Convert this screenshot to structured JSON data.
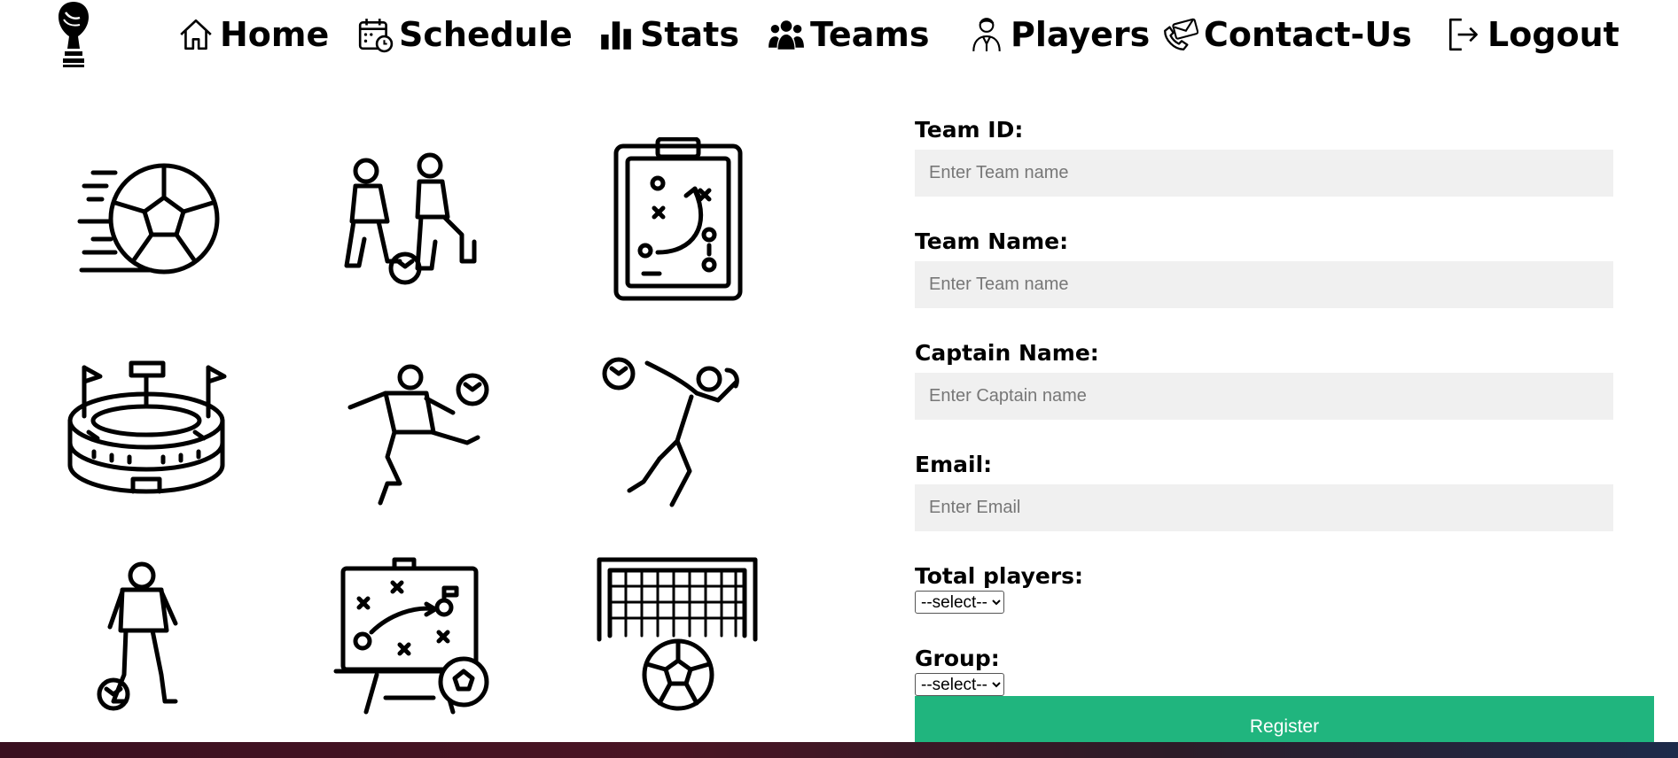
{
  "nav": {
    "home": "Home",
    "schedule": "Schedule",
    "stats": "Stats",
    "teams": "Teams",
    "players": "Players",
    "contact": "Contact-Us",
    "logout": "Logout"
  },
  "icons": {
    "logo": "trophy-icon",
    "home": "house-icon",
    "schedule": "calendar-clock-icon",
    "stats": "bar-chart-icon",
    "teams": "group-icon",
    "players": "player-icon",
    "contact": "phone-envelope-icon",
    "logout": "logout-icon",
    "grid": [
      "speeding-ball-icon",
      "two-players-icon",
      "tactics-clipboard-icon",
      "stadium-icon",
      "kicking-player-icon",
      "goalkeeper-icon",
      "dribbling-player-icon",
      "tactics-board-icon",
      "goal-net-icon"
    ]
  },
  "form": {
    "team_id_label": "Team ID:",
    "team_id_placeholder": "Enter Team name",
    "team_name_label": "Team Name:",
    "team_name_placeholder": "Enter Team name",
    "captain_label": "Captain Name:",
    "captain_placeholder": "Enter Captain name",
    "email_label": "Email:",
    "email_placeholder": "Enter Email",
    "total_players_label": "Total players:",
    "total_players_value": "--select--",
    "group_label": "Group:",
    "group_value": "--select--",
    "register_label": "Register"
  },
  "colors": {
    "accent": "#20b57e",
    "input_bg": "#f0f0f0"
  }
}
